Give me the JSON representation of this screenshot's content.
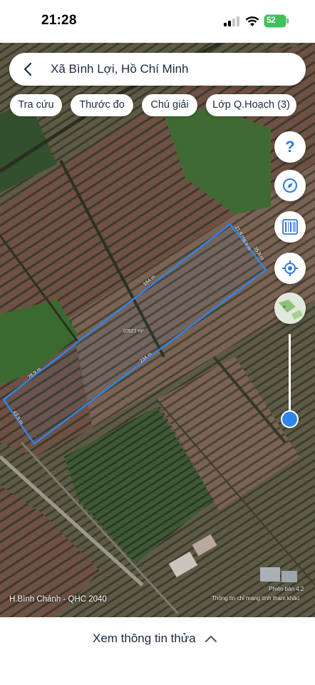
{
  "status_bar": {
    "time": "21:28",
    "battery": "52"
  },
  "search": {
    "location": "Xã Bình Lợi, Hồ Chí Minh"
  },
  "chips": [
    "Tra cứu",
    "Thước đo",
    "Chú giải",
    "Lớp Q.Hoạch (3)"
  ],
  "side_buttons": {
    "help": "?"
  },
  "map_labels": {
    "top_edge": "21.9 m",
    "top_edge_2": "8.9 m",
    "right_edge": "25.8 m",
    "long_top": "164 m",
    "long_bottom": "234 m",
    "left_edge": "78.9 m",
    "bottom_edge": "43.9 m",
    "area": "10527 m²"
  },
  "footer": {
    "region": "H.Bình Chánh - QHC 2040",
    "version": "Phiên bản 4.2",
    "disclaimer": "Thông tin chỉ mang tính tham khảo"
  },
  "bottom_panel": {
    "label": "Xem thông tin thửa"
  },
  "colors": {
    "accent": "#2e7ad8",
    "parcel_outline": "#2f86e8"
  }
}
